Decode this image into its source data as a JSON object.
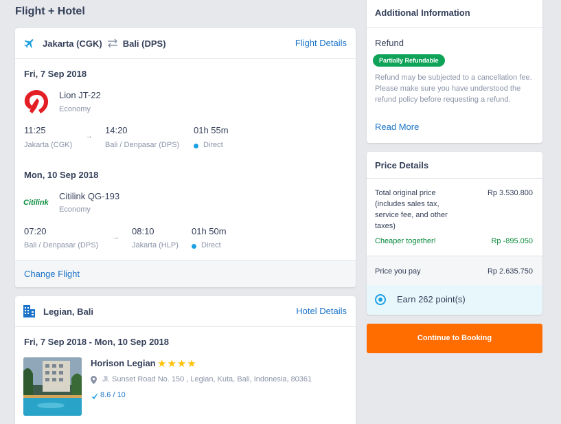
{
  "page": {
    "title": "Flight + Hotel"
  },
  "flight": {
    "origin": "Jakarta (CGK)",
    "destination": "Bali (DPS)",
    "details_link": "Flight Details",
    "change_link": "Change Flight",
    "legs": [
      {
        "date": "Fri, 7 Sep 2018",
        "airline": "Lion JT-22",
        "cabin": "Economy",
        "dep_time": "11:25",
        "dep_place": "Jakarta (CGK)",
        "arr_time": "14:20",
        "arr_place": "Bali / Denpasar (DPS)",
        "duration": "01h 55m",
        "stops": "Direct"
      },
      {
        "date": "Mon, 10 Sep 2018",
        "airline": "Citilink QG-193",
        "airline_logo_text": "Citilink",
        "cabin": "Economy",
        "dep_time": "07:20",
        "dep_place": "Bali / Denpasar (DPS)",
        "arr_time": "08:10",
        "arr_place": "Jakarta (HLP)",
        "duration": "01h 50m",
        "stops": "Direct"
      }
    ]
  },
  "hotel": {
    "location": "Legian, Bali",
    "details_link": "Hotel Details",
    "dates": "Fri, 7 Sep 2018 - Mon, 10 Sep 2018",
    "name": "Horison Legian",
    "stars": "★★★★",
    "address": "Jl. Sunset Road No. 150 , Legian, Kuta, Bali, Indonesia, 80361",
    "rating": "8.6 / 10"
  },
  "additional": {
    "title": "Additional Information",
    "refund_label": "Refund",
    "badge": "Partially Refundable",
    "text": "Refund may be subjected to a cancellation fee. Please make sure you have understood the refund policy before requesting a refund.",
    "read_more": "Read More"
  },
  "price": {
    "title": "Price Details",
    "original_label": "Total original price (includes sales tax, service fee, and other taxes)",
    "original_value": "Rp 3.530.800",
    "cheaper_label": "Cheaper together!",
    "cheaper_value": "Rp -895.050",
    "pay_label": "Price you pay",
    "pay_value": "Rp 2.635.750",
    "points": "Earn 262 point(s)"
  },
  "cta": {
    "label": "Continue to Booking"
  },
  "colors": {
    "accent": "#1a73c8",
    "cta": "#ff6d00",
    "badge": "#0fa35a",
    "points_bg": "#e8f7fc"
  }
}
